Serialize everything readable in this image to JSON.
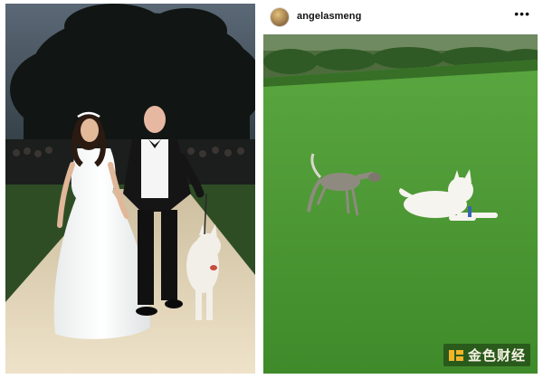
{
  "post": {
    "username": "angelasmeng",
    "more_label": "•••"
  },
  "watermark": {
    "text": "金色财经"
  },
  "icons": {
    "avatar": "profile-avatar",
    "more": "more-options-icon",
    "watermark_logo": "brand-logo-icon"
  },
  "colors": {
    "grass": "#4e9a34",
    "aisle": "#e6d8bf",
    "sky": "#3c4a56",
    "watermark_accent": "#f4b429"
  }
}
